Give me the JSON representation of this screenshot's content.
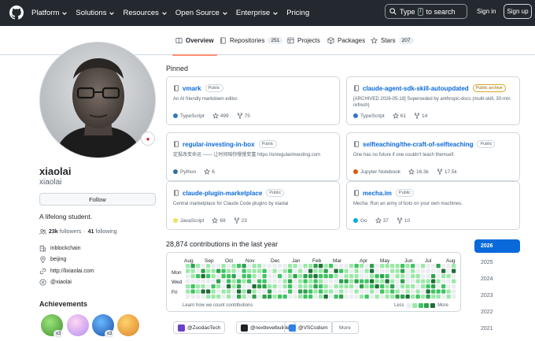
{
  "header": {
    "nav": [
      "Platform",
      "Solutions",
      "Resources",
      "Open Source",
      "Enterprise",
      "Pricing"
    ],
    "nav_dropdown": [
      true,
      true,
      true,
      true,
      true,
      false
    ],
    "search_prefix": "Type",
    "search_key": "/",
    "search_suffix": "to search",
    "sign_in": "Sign in",
    "sign_up": "Sign up"
  },
  "tabs": {
    "overview": "Overview",
    "repositories": "Repositories",
    "repositories_count": "251",
    "projects": "Projects",
    "packages": "Packages",
    "stars": "Stars",
    "stars_count": "207"
  },
  "profile": {
    "name": "xiaolai",
    "username": "xiaolai",
    "follow": "Follow",
    "bio": "A lifelong student.",
    "followers": "23k",
    "followers_label": "followers",
    "separator": "·",
    "following": "41",
    "following_label": "following",
    "company": "inblockchain",
    "location": "beijing",
    "website": "http://lixiaolai.com",
    "social": "@xiaolai"
  },
  "achievements": {
    "title": "Achievements",
    "badges": [
      {
        "icon": "pull-shark-badge",
        "count": "x3"
      },
      {
        "icon": "yolo-badge",
        "count": ""
      },
      {
        "icon": "starstruck-badge",
        "count": "x3"
      },
      {
        "icon": "quickdraw-badge",
        "count": ""
      }
    ]
  },
  "pinned": {
    "title": "Pinned",
    "repos": [
      {
        "name": "vmark",
        "visibility": "Public",
        "archived": false,
        "description": "An AI friendly markdown editor.",
        "language": "TypeScript",
        "lang_color": "#3178c6",
        "stars": "499",
        "forks": "75"
      },
      {
        "name": "claude-agent-sdk-skill-autoupdated",
        "visibility": "Public archive",
        "archived": true,
        "description": "[ARCHIVED 2026-05-18] Superseded by anthropic-docs (multi-skill, 30-min refresh)",
        "language": "TypeScript",
        "lang_color": "#3178c6",
        "stars": "61",
        "forks": "14"
      },
      {
        "name": "regular-investing-in-box",
        "visibility": "Public",
        "archived": false,
        "description": "定投改变命运 —— 让时间陪你慢慢变富 https://onregularinvesting.com",
        "language": "Python",
        "lang_color": "#3572a5",
        "stars": "6",
        "forks": ""
      },
      {
        "name": "selfteaching/the-craft-of-selfteaching",
        "visibility": "Public",
        "archived": false,
        "description": "One has no future if one couldn't teach themself.",
        "language": "Jupyter Notebook",
        "lang_color": "#da5b0b",
        "stars": "16.3k",
        "forks": "17.5k"
      },
      {
        "name": "claude-plugin-marketplace",
        "visibility": "Public",
        "archived": false,
        "description": "Central marketplace for Claude Code plugins by xiaolai",
        "language": "JavaScript",
        "lang_color": "#f1e05a",
        "stars": "69",
        "forks": "23"
      },
      {
        "name": "mecha.im",
        "visibility": "Public",
        "archived": false,
        "description": "Mecha: Run an army of bots on your own machines.",
        "language": "Go",
        "lang_color": "#00add8",
        "stars": "37",
        "forks": "10"
      }
    ]
  },
  "contributions": {
    "title": "28,874 contributions in the last year",
    "months": [
      "Aug",
      "Sep",
      "Oct",
      "Nov",
      "Dec",
      "Jan",
      "Feb",
      "Mar",
      "Apr",
      "May",
      "Jun",
      "Jul",
      "Aug"
    ],
    "days": [
      "Mon",
      "Wed",
      "Fri"
    ],
    "learn": "Learn how we count contributions",
    "less": "Less",
    "more": "More",
    "colors": [
      "#ebedf0",
      "#9be9a8",
      "#40c463",
      "#30a14e",
      "#216e39"
    ]
  },
  "orgs": [
    "@ZuodaoTech",
    "@nextlevelbuilder",
    "@VSCodium"
  ],
  "orgs_more": "More",
  "years": [
    "2026",
    "2025",
    "2024",
    "2023",
    "2022",
    "2021"
  ],
  "active_year": "2026"
}
